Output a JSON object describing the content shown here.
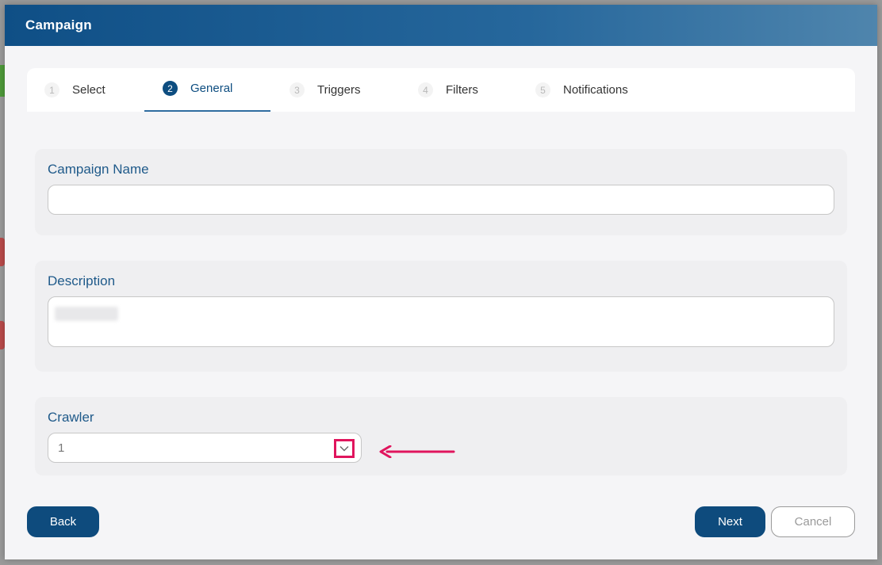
{
  "modal": {
    "title": "Campaign"
  },
  "steps": [
    {
      "num": "1",
      "label": "Select"
    },
    {
      "num": "2",
      "label": "General"
    },
    {
      "num": "3",
      "label": "Triggers"
    },
    {
      "num": "4",
      "label": "Filters"
    },
    {
      "num": "5",
      "label": "Notifications"
    }
  ],
  "active_step": "General",
  "form": {
    "campaign_name": {
      "label": "Campaign Name",
      "value": ""
    },
    "description": {
      "label": "Description",
      "value": ""
    },
    "crawler": {
      "label": "Crawler",
      "value": "1"
    }
  },
  "buttons": {
    "back": "Back",
    "next": "Next",
    "cancel": "Cancel"
  },
  "colors": {
    "primary": "#0e4b7d",
    "label": "#1f5a8a",
    "annotation": "#e0155d"
  }
}
